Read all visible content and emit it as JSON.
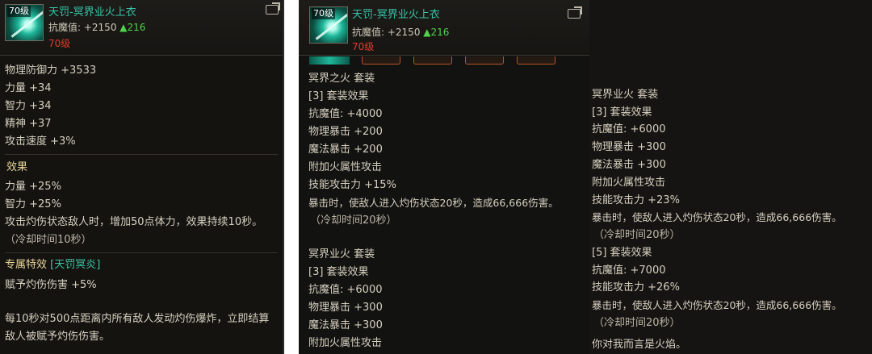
{
  "item": {
    "level_badge": "70级",
    "name": "天罚-冥界业火上衣",
    "resist_label": "抗魔值: +2150",
    "resist_up": "▲216",
    "level_req": "70级"
  },
  "panel1": {
    "base_stats": [
      "物理防御力 +3533",
      "力量 +34",
      "智力 +34",
      "精神 +37",
      "攻击速度 +3%"
    ],
    "effect_title": "效果",
    "effects": [
      "力量 +25%",
      "智力 +25%",
      "攻击灼伤状态敌人时，增加50点体力，效果持续10秒。",
      "（冷却时间10秒）"
    ],
    "exclusive_title": "专属特效",
    "exclusive_tag": "[天罚冥炎]",
    "exclusive_lines": [
      "赋予灼伤伤害 +5%",
      "每10秒对500点距离内所有敌人发动灼伤爆炸，立即结算",
      "敌人被赋予灼伤伤害。"
    ]
  },
  "panel2": {
    "lines": [
      "冥界之火  套装",
      "[3] 套装效果",
      "抗魔值: +4000",
      "物理暴击 +200",
      "魔法暴击 +200",
      "附加火属性攻击",
      "技能攻击力 +15%",
      "暴击时，使敌人进入灼伤状态20秒，造成66,666伤害。",
      "（冷却时间20秒）",
      "冥界业火  套装",
      "[3] 套装效果",
      "抗魔值: +6000",
      "物理暴击 +300",
      "魔法暴击 +300",
      "附加火属性攻击"
    ]
  },
  "panel3": {
    "lines": [
      "冥界业火  套装",
      "[3] 套装效果",
      "抗魔值: +6000",
      "物理暴击 +300",
      "魔法暴击 +300",
      "附加火属性攻击",
      "技能攻击力 +23%",
      "暴击时，使敌人进入灼伤状态20秒，造成66,666伤害。",
      "（冷却时间20秒）",
      "[5] 套装效果",
      "抗魔值: +7000",
      "技能攻击力 +26%",
      "暴击时，使敌人进入灼伤状态20秒，造成66,666伤害。",
      "（冷却时间20秒）",
      "你对我而言是火焰。"
    ]
  },
  "icons": {
    "item": "armor-item-icon",
    "share": "share-icon"
  },
  "colors": {
    "name": "#38c4a7",
    "stat_up": "#52d24c",
    "level_req": "#e23b2e",
    "section": "#e9d49a"
  }
}
